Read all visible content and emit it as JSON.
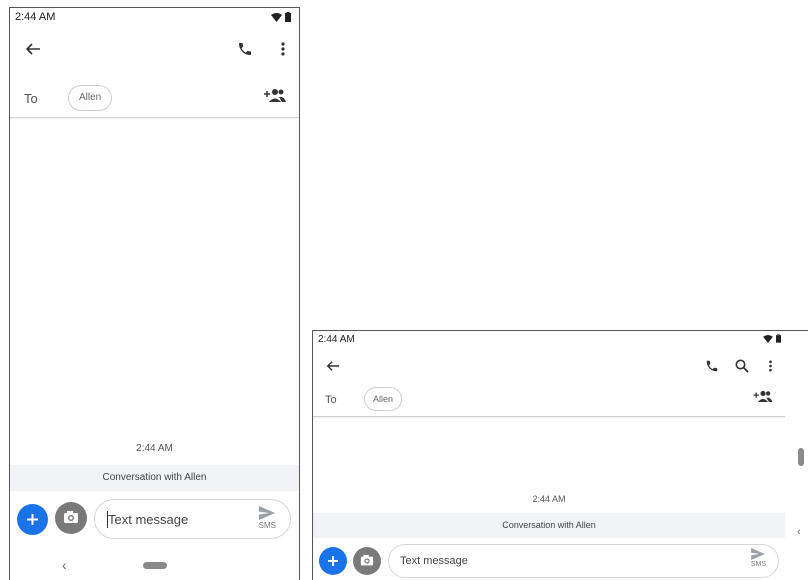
{
  "colors": {
    "accent": "#1a73e8",
    "camera_button": "#7a7a7a",
    "conversation_banner": "#f1f3f4",
    "border": "#555555"
  },
  "portrait": {
    "status_time": "2:44 AM",
    "status_icons": [
      "wifi-icon",
      "battery-icon"
    ],
    "toolbar": {
      "icons": [
        "back-arrow-icon",
        "phone-icon",
        "more-vert-icon"
      ]
    },
    "to_label": "To",
    "recipient_chip": "Allen",
    "add_person_icon": "add-person-icon",
    "message_time": "2:44 AM",
    "conversation_label": "Conversation with Allen",
    "compose": {
      "placeholder": "Text message",
      "send_label": "SMS",
      "icons": [
        "plus-icon",
        "camera-icon",
        "send-icon"
      ]
    },
    "nav": {
      "back_glyph": "‹"
    }
  },
  "landscape": {
    "status_time": "2:44 AM",
    "status_icons": [
      "wifi-icon",
      "battery-icon"
    ],
    "toolbar": {
      "icons": [
        "back-arrow-icon",
        "phone-icon",
        "search-icon",
        "more-vert-icon"
      ]
    },
    "to_label": "To",
    "recipient_chip": "Allen",
    "add_person_icon": "add-person-icon",
    "message_time": "2:44 AM",
    "conversation_label": "Conversation with Allen",
    "compose": {
      "placeholder": "Text message",
      "send_label": "SMS",
      "icons": [
        "plus-icon",
        "camera-icon",
        "send-icon"
      ]
    },
    "nav": {
      "back_glyph": "‹"
    }
  }
}
